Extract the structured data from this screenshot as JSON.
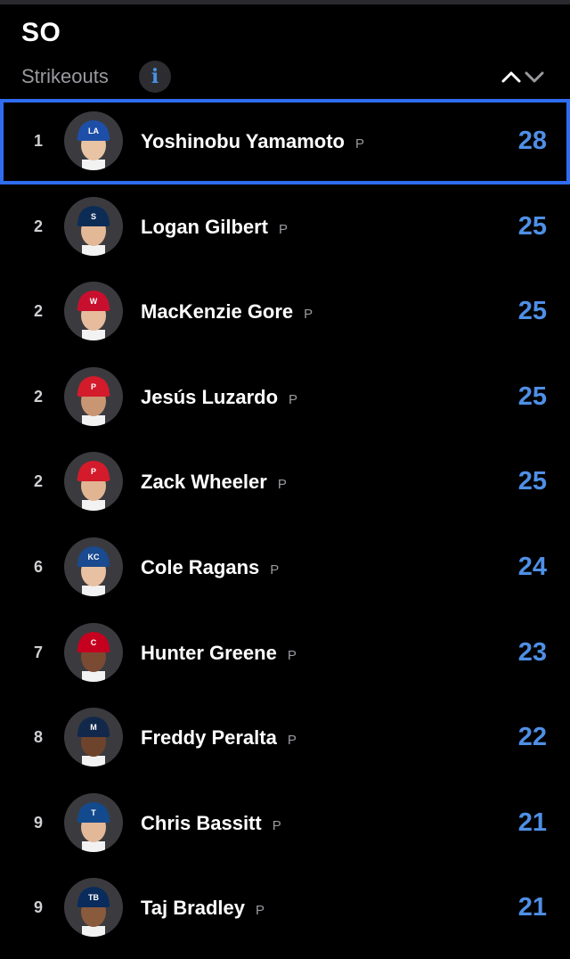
{
  "header": {
    "title": "SO",
    "subtitle": "Strikeouts",
    "info_icon": "info-icon",
    "sort_icon": "chevron-up-down-icon"
  },
  "colors": {
    "accent": "#4f8fe6",
    "selection": "#2f6cf0",
    "background": "#000000"
  },
  "leaders": [
    {
      "rank": "1",
      "name": "Yoshinobu Yamamoto",
      "pos": "P",
      "value": "28",
      "cap": "#1e4fa8",
      "logo": "LA",
      "skin": "#e8c3a4",
      "selected": true
    },
    {
      "rank": "2",
      "name": "Logan Gilbert",
      "pos": "P",
      "value": "25",
      "cap": "#0c2c56",
      "logo": "S",
      "skin": "#e3b896",
      "selected": false
    },
    {
      "rank": "2",
      "name": "MacKenzie Gore",
      "pos": "P",
      "value": "25",
      "cap": "#c8102e",
      "logo": "W",
      "skin": "#e6bc9c",
      "selected": false
    },
    {
      "rank": "2",
      "name": "Jesús Luzardo",
      "pos": "P",
      "value": "25",
      "cap": "#d31b2c",
      "logo": "P",
      "skin": "#c99673",
      "selected": false
    },
    {
      "rank": "2",
      "name": "Zack Wheeler",
      "pos": "P",
      "value": "25",
      "cap": "#d31b2c",
      "logo": "P",
      "skin": "#e2b592",
      "selected": false
    },
    {
      "rank": "6",
      "name": "Cole Ragans",
      "pos": "P",
      "value": "24",
      "cap": "#1a4a8f",
      "logo": "KC",
      "skin": "#e8c1a2",
      "selected": false
    },
    {
      "rank": "7",
      "name": "Hunter Greene",
      "pos": "P",
      "value": "23",
      "cap": "#c6011f",
      "logo": "C",
      "skin": "#7a4b32",
      "selected": false
    },
    {
      "rank": "8",
      "name": "Freddy Peralta",
      "pos": "P",
      "value": "22",
      "cap": "#12284b",
      "logo": "M",
      "skin": "#6e432c",
      "selected": false
    },
    {
      "rank": "9",
      "name": "Chris Bassitt",
      "pos": "P",
      "value": "21",
      "cap": "#134a8e",
      "logo": "T",
      "skin": "#e2b898",
      "selected": false
    },
    {
      "rank": "9",
      "name": "Taj Bradley",
      "pos": "P",
      "value": "21",
      "cap": "#092c5c",
      "logo": "TB",
      "skin": "#8a5a3c",
      "selected": false
    }
  ]
}
